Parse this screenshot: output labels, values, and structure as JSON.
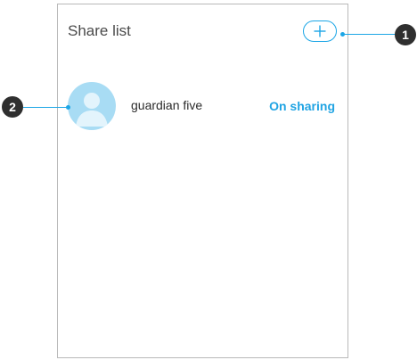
{
  "share_list": {
    "title": "Share list",
    "add_icon": "plus-icon",
    "items": [
      {
        "name": "guardian five",
        "status": "On sharing",
        "avatar_icon": "user-avatar-icon"
      }
    ]
  },
  "callouts": [
    "1",
    "2"
  ],
  "colors": {
    "accent": "#1ca6e6",
    "avatar_bg": "#a8dcf4",
    "badge": "#2f2f2f",
    "border": "#b9b9b9"
  }
}
